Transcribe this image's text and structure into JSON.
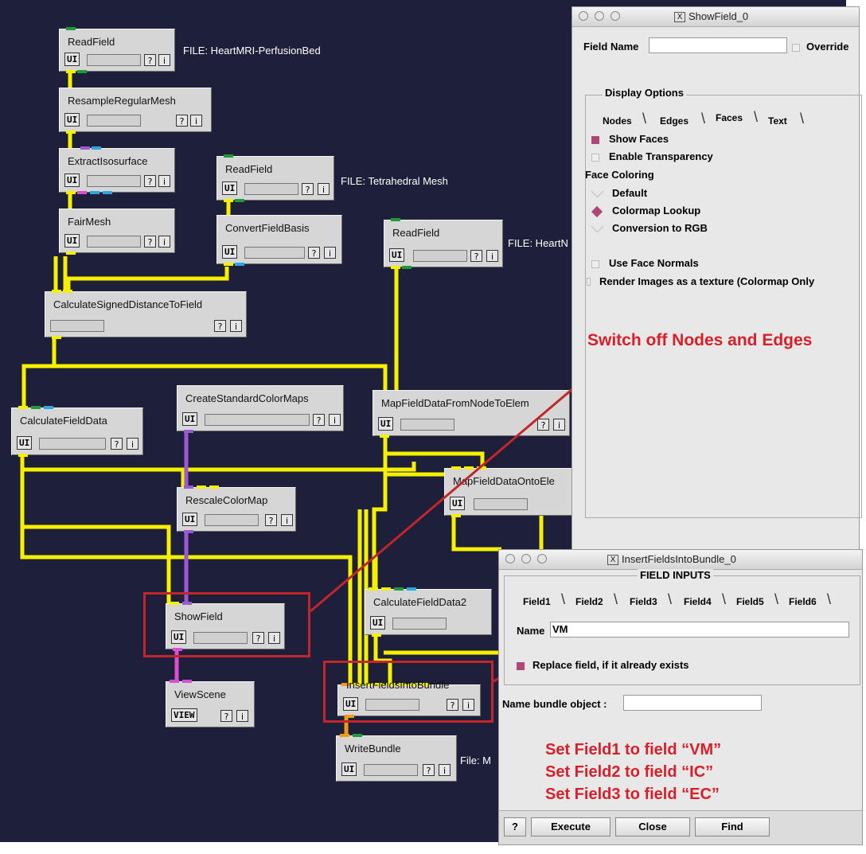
{
  "network": {
    "modules": {
      "readfield1": {
        "title": "ReadField",
        "ui": "UI",
        "help": "?",
        "info": "i"
      },
      "resample": {
        "title": "ResampleRegularMesh",
        "ui": "UI",
        "help": "?",
        "info": "i"
      },
      "extractiso": {
        "title": "ExtractIsosurface",
        "ui": "UI",
        "help": "?",
        "info": "i"
      },
      "fairmesh": {
        "title": "FairMesh",
        "ui": "UI",
        "help": "?",
        "info": "i"
      },
      "readfield2": {
        "title": "ReadField",
        "ui": "UI",
        "help": "?",
        "info": "i"
      },
      "convertbasis": {
        "title": "ConvertFieldBasis",
        "ui": "UI",
        "help": "?",
        "info": "i"
      },
      "readfield3": {
        "title": "ReadField",
        "ui": "UI",
        "help": "?",
        "info": "i"
      },
      "calcsigned": {
        "title": "CalculateSignedDistanceToField",
        "help": "?",
        "info": "i"
      },
      "calcfield": {
        "title": "CalculateFieldData",
        "ui": "UI",
        "help": "?",
        "info": "i"
      },
      "createcmap": {
        "title": "CreateStandardColorMaps",
        "ui": "UI",
        "help": "?",
        "info": "i"
      },
      "mapnode": {
        "title": "MapFieldDataFromNodeToElem",
        "ui": "UI",
        "help": "?",
        "info": "i"
      },
      "maponto": {
        "title": "MapFieldDataOntoEle",
        "ui": "UI"
      },
      "rescale": {
        "title": "RescaleColorMap",
        "ui": "UI",
        "help": "?",
        "info": "i"
      },
      "showfield": {
        "title": "ShowField",
        "ui": "UI",
        "help": "?",
        "info": "i"
      },
      "calcfield2": {
        "title": "CalculateFieldData2",
        "ui": "UI"
      },
      "viewscene": {
        "title": "ViewScene",
        "ui": "VIEW",
        "help": "?",
        "info": "i"
      },
      "insertfields": {
        "title": "InsertFieldsIntoBundle",
        "ui": "UI",
        "help": "?",
        "info": "i"
      },
      "writebundle": {
        "title": "WriteBundle",
        "ui": "UI",
        "help": "?",
        "info": "i"
      }
    },
    "file_labels": {
      "heart_mri": "FILE: HeartMRI-PerfusionBed",
      "tetra": "FILE: Tetrahedral Mesh",
      "heart_n": "FILE: HeartN",
      "write": "File: M"
    },
    "wire_colors": {
      "field": "#f5f000",
      "colormap": "#9b59d6",
      "geometry": "#d94fd0",
      "bundle": "#f09a1a"
    }
  },
  "annotations": {
    "switch_off": "Switch off Nodes and Edges",
    "set_fields": [
      "Set Field1 to field “VM”",
      "Set Field2 to field “IC”",
      "Set Field3 to field “EC”"
    ],
    "color": "#d8202a"
  },
  "showfield_window": {
    "title": "ShowField_0",
    "field_name_label": "Field Name",
    "field_name_value": "",
    "override_label": "Override",
    "display_options_label": "Display Options",
    "tabs": [
      "Nodes",
      "Edges",
      "Faces",
      "Text"
    ],
    "active_tab": "Faces",
    "show_faces": "Show Faces",
    "enable_transparency": "Enable Transparency",
    "face_coloring": "Face Coloring",
    "default": "Default",
    "colormap_lookup": "Colormap Lookup",
    "conversion_rgb": "Conversion to RGB",
    "use_face_normals": "Use Face Normals",
    "render_images": "Render Images as a texture (Colormap Only"
  },
  "insert_window": {
    "title": "InsertFieldsIntoBundle_0",
    "field_inputs": "FIELD INPUTS",
    "tabs": [
      "Field1",
      "Field2",
      "Field3",
      "Field4",
      "Field5",
      "Field6"
    ],
    "active_tab": "Field1",
    "name_label": "Name",
    "name_value": "VM",
    "replace_label": "Replace field, if it already exists",
    "bundle_label": "Name bundle object :",
    "bundle_value": "",
    "help_button": "?",
    "execute_button": "Execute",
    "close_button": "Close",
    "find_button": "Find"
  }
}
